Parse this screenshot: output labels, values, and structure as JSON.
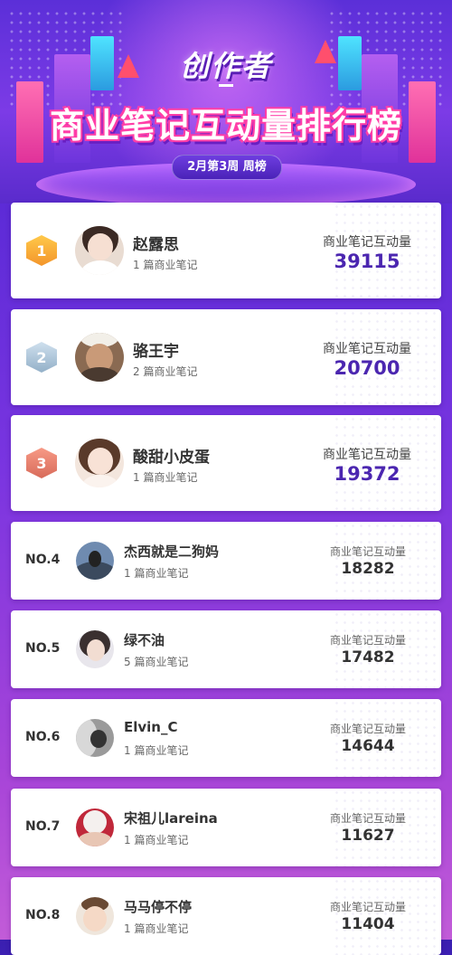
{
  "header": {
    "subtitle": "创作者",
    "title": "商业笔记互动量排行榜",
    "week": "2月第3周 周榜"
  },
  "colors": {
    "accent": "#4b26b0",
    "gold": "#f3952b",
    "silver": "#93b0c8",
    "bronze": "#d86b5a"
  },
  "entries": [
    {
      "rank": "1",
      "name": "赵露思",
      "notes": "1 篇商业笔记",
      "stat_label": "商业笔记互动量",
      "value": "39115"
    },
    {
      "rank": "2",
      "name": "骆王宇",
      "notes": "2 篇商业笔记",
      "stat_label": "商业笔记互动量",
      "value": "20700"
    },
    {
      "rank": "3",
      "name": "酸甜小皮蛋",
      "notes": "1 篇商业笔记",
      "stat_label": "商业笔记互动量",
      "value": "19372"
    },
    {
      "rank": "NO.4",
      "name": "杰西就是二狗妈",
      "notes": "1 篇商业笔记",
      "stat_label": "商业笔记互动量",
      "value": "18282"
    },
    {
      "rank": "NO.5",
      "name": "绿不油",
      "notes": "5 篇商业笔记",
      "stat_label": "商业笔记互动量",
      "value": "17482"
    },
    {
      "rank": "NO.6",
      "name": "Elvin_C",
      "notes": "1 篇商业笔记",
      "stat_label": "商业笔记互动量",
      "value": "14644"
    },
    {
      "rank": "NO.7",
      "name": "宋祖儿lareina",
      "notes": "1 篇商业笔记",
      "stat_label": "商业笔记互动量",
      "value": "11627"
    },
    {
      "rank": "NO.8",
      "name": "马马停不停",
      "notes": "1 篇商业笔记",
      "stat_label": "商业笔记互动量",
      "value": "11404"
    }
  ]
}
